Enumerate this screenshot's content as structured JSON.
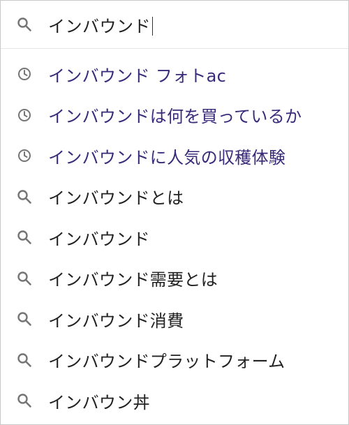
{
  "search": {
    "query": "インバウンド",
    "icon": "search-icon"
  },
  "suggestions": [
    {
      "type": "history",
      "icon": "history-clock-icon",
      "label": "インバウンド フォトac"
    },
    {
      "type": "history",
      "icon": "history-clock-icon",
      "label": "インバウンドは何を買っているか"
    },
    {
      "type": "history",
      "icon": "history-clock-icon",
      "label": "インバウンドに人気の収穫体験"
    },
    {
      "type": "suggest",
      "icon": "search-icon",
      "label": "インバウンドとは"
    },
    {
      "type": "suggest",
      "icon": "search-icon",
      "label": "インバウンド"
    },
    {
      "type": "suggest",
      "icon": "search-icon",
      "label": "インバウンド需要とは"
    },
    {
      "type": "suggest",
      "icon": "search-icon",
      "label": "インバウンド消費"
    },
    {
      "type": "suggest",
      "icon": "search-icon",
      "label": "インバウンドプラットフォーム"
    },
    {
      "type": "suggest",
      "icon": "search-icon",
      "label": "インバウン丼"
    }
  ],
  "colors": {
    "history_text": "#3a2a7a",
    "suggest_text": "#222222",
    "icon": "#757575"
  }
}
